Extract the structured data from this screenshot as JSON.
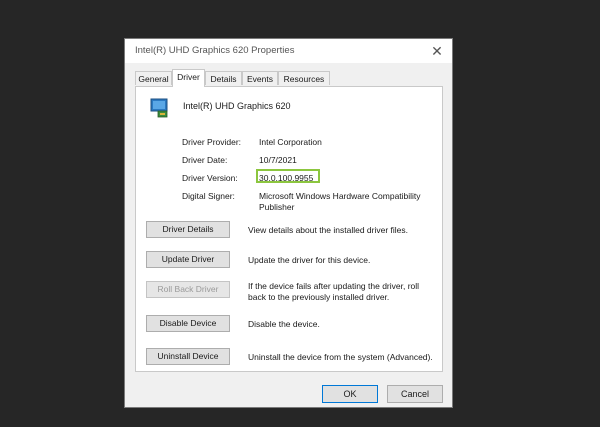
{
  "window": {
    "title": "Intel(R) UHD Graphics 620 Properties",
    "close_glyph": "✕"
  },
  "tabs": [
    {
      "label": "General",
      "active": false
    },
    {
      "label": "Driver",
      "active": true
    },
    {
      "label": "Details",
      "active": false
    },
    {
      "label": "Events",
      "active": false
    },
    {
      "label": "Resources",
      "active": false
    }
  ],
  "device": {
    "icon": "display-adapter-icon",
    "name": "Intel(R) UHD Graphics 620"
  },
  "properties": {
    "provider_label": "Driver Provider:",
    "provider_value": "Intel Corporation",
    "date_label": "Driver Date:",
    "date_value": "10/7/2021",
    "version_label": "Driver Version:",
    "version_value": "30.0.100.9955",
    "signer_label": "Digital Signer:",
    "signer_value": "Microsoft Windows Hardware Compatibility Publisher"
  },
  "actions": [
    {
      "label": "Driver Details",
      "description": "View details about the installed driver files.",
      "enabled": true
    },
    {
      "label": "Update Driver",
      "description": "Update the driver for this device.",
      "enabled": true
    },
    {
      "label": "Roll Back Driver",
      "description": "If the device fails after updating the driver, roll back to the previously installed driver.",
      "enabled": false
    },
    {
      "label": "Disable Device",
      "description": "Disable the device.",
      "enabled": true
    },
    {
      "label": "Uninstall Device",
      "description": "Uninstall the device from the system (Advanced).",
      "enabled": true
    }
  ],
  "footer": {
    "ok": "OK",
    "cancel": "Cancel"
  },
  "colors": {
    "highlight": "#8cc63f",
    "background": "#262626"
  }
}
